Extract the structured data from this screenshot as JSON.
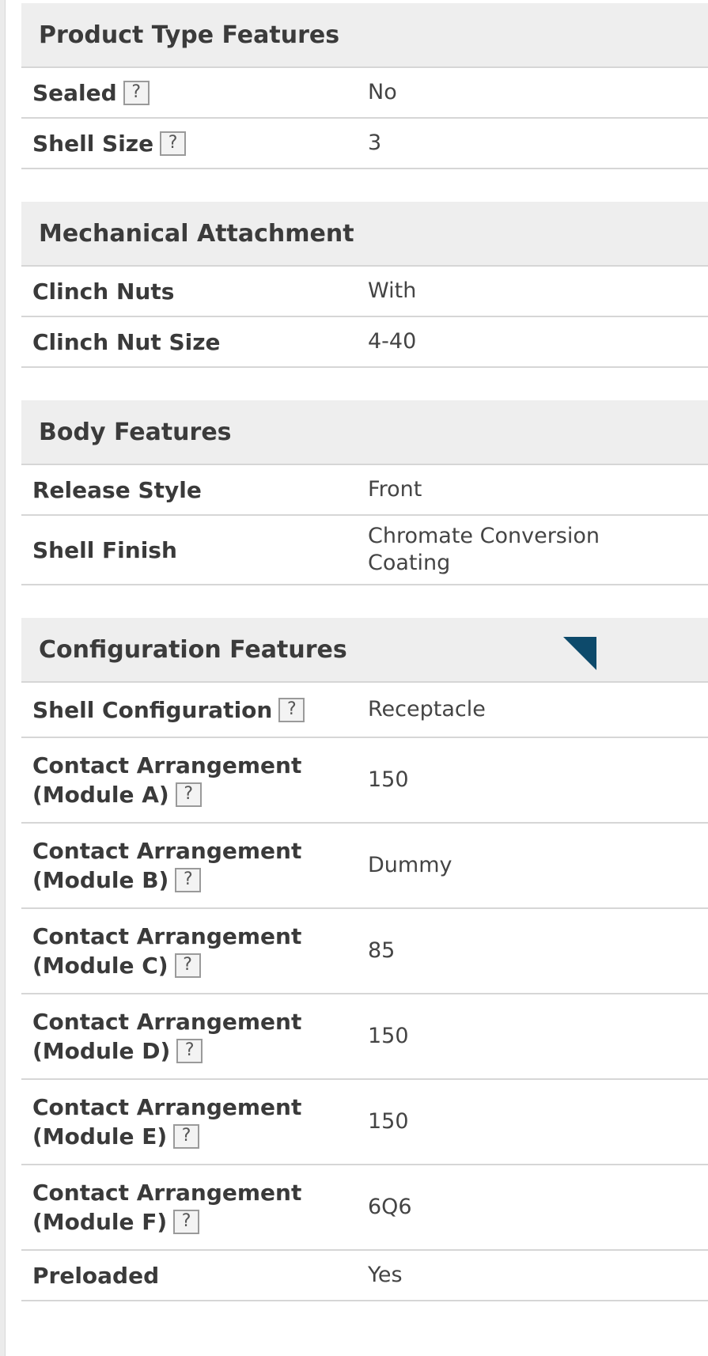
{
  "sections": [
    {
      "title": "Product Type Features",
      "rows": [
        {
          "label": "Sealed",
          "value": "No",
          "help": "?"
        },
        {
          "label": "Shell Size",
          "value": "3",
          "help": "?"
        }
      ]
    },
    {
      "title": "Mechanical Attachment",
      "rows": [
        {
          "label": "Clinch Nuts",
          "value": "With"
        },
        {
          "label": "Clinch Nut Size",
          "value": "4-40"
        }
      ]
    },
    {
      "title": "Body Features",
      "rows": [
        {
          "label": "Release Style",
          "value": "Front"
        },
        {
          "label": "Shell Finish",
          "value": "Chromate Conversion Coating"
        }
      ]
    },
    {
      "title": "Configuration Features",
      "rows": [
        {
          "label": "Shell Configuration",
          "value": "Receptacle",
          "help": "?"
        },
        {
          "label": "Contact Arrangement (Module A)",
          "value": "150",
          "help": "?"
        },
        {
          "label": "Contact Arrangement (Module B)",
          "value": "Dummy",
          "help": "?"
        },
        {
          "label": "Contact Arrangement (Module C)",
          "value": "85",
          "help": "?"
        },
        {
          "label": "Contact Arrangement (Module D)",
          "value": "150",
          "help": "?"
        },
        {
          "label": "Contact Arrangement (Module E)",
          "value": "150",
          "help": "?"
        },
        {
          "label": "Contact Arrangement (Module F)",
          "value": "6Q6",
          "help": "?"
        },
        {
          "label": "Preloaded",
          "value": "Yes"
        }
      ]
    }
  ],
  "icons": {
    "help": "question-mark-icon",
    "collapse": "corner-triangle-icon",
    "collapse_color": "#0d4a6b"
  }
}
